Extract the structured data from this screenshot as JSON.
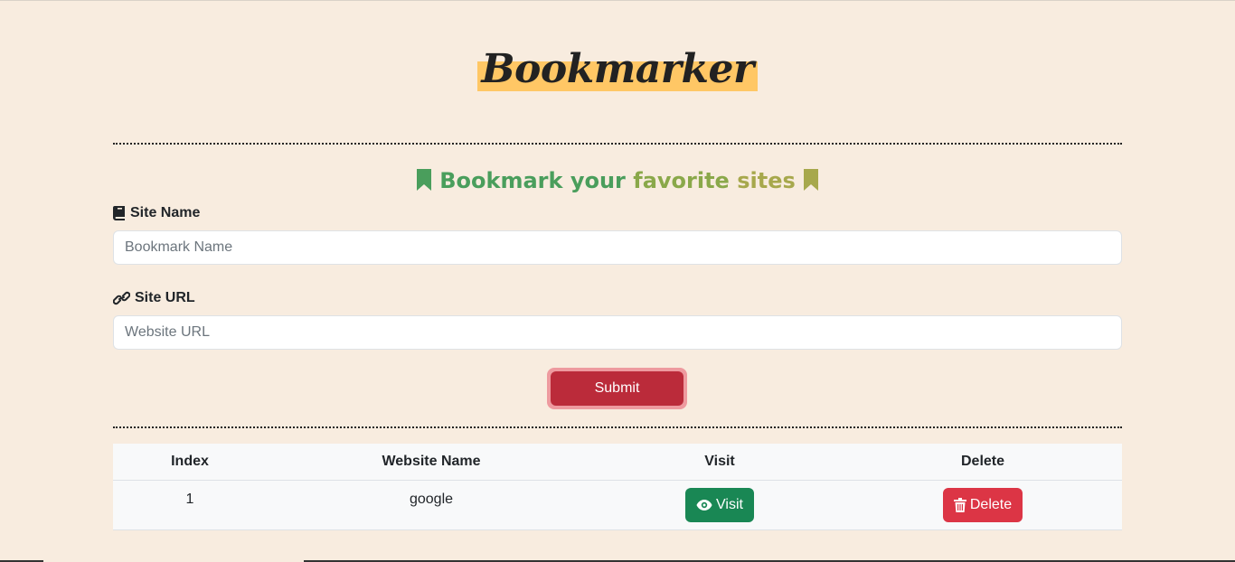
{
  "header": {
    "title": "Bookmarker"
  },
  "form": {
    "heading_part1": "Bookmark your",
    "heading_part2": "favorite",
    "heading_part3": "sites",
    "site_name_label": "Site Name",
    "site_name_value": "",
    "site_name_placeholder": "Bookmark Name",
    "site_url_label": "Site URL",
    "site_url_value": "",
    "site_url_placeholder": "Website URL",
    "submit_label": "Submit"
  },
  "table": {
    "headers": [
      "Index",
      "Website Name",
      "Visit",
      "Delete"
    ],
    "rows": [
      {
        "index": "1",
        "name": "google",
        "visit_label": "Visit",
        "delete_label": "Delete"
      }
    ]
  },
  "colors": {
    "background": "#f8ecdf",
    "title_highlight": "#ffc765",
    "heading_green": "#4a9e5c",
    "heading_olive": "#a7a84c",
    "submit": "#bb2b3a",
    "visit": "#198754",
    "delete": "#dc3545"
  },
  "icons": {
    "heading_left": "bookmark-icon",
    "heading_right": "bookmark-icon",
    "site_name": "book-icon",
    "site_url": "link-icon",
    "visit": "eye-icon",
    "delete": "trash-icon"
  }
}
